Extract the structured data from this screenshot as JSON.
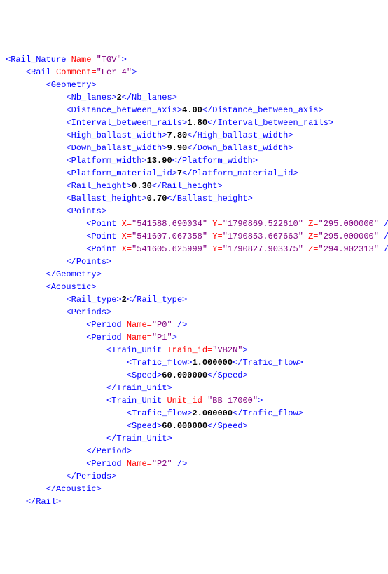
{
  "rail_nature": {
    "name_attr": "TGV"
  },
  "rail": {
    "comment_attr": "Fer 4"
  },
  "geometry": {
    "nb_lanes": "2",
    "distance_between_axis": "4.00",
    "interval_between_rails": "1.80",
    "high_ballast_width": "7.80",
    "down_ballast_width": "9.90",
    "platform_width": "13.90",
    "platform_material_id": "7",
    "rail_height": "0.30",
    "ballast_height": "0.70",
    "points": [
      {
        "x": "541588.690034",
        "y": "1790869.522610",
        "z": "295.000000"
      },
      {
        "x": "541607.067358",
        "y": "1790853.667663",
        "z": "295.000000"
      },
      {
        "x": "541605.625999",
        "y": "1790827.903375",
        "z": "294.902313"
      }
    ]
  },
  "acoustic": {
    "rail_type": "2",
    "periods": [
      {
        "name": "P0",
        "train_units": []
      },
      {
        "name": "P1",
        "train_units": [
          {
            "id_attr": "Train_id",
            "id_val": "VB2N",
            "trafic_flow": "1.000000",
            "speed": "60.000000"
          },
          {
            "id_attr": "Unit_id",
            "id_val": "BB 17000",
            "trafic_flow": "2.000000",
            "speed": "60.000000"
          }
        ]
      },
      {
        "name": "P2",
        "train_units": []
      }
    ]
  }
}
